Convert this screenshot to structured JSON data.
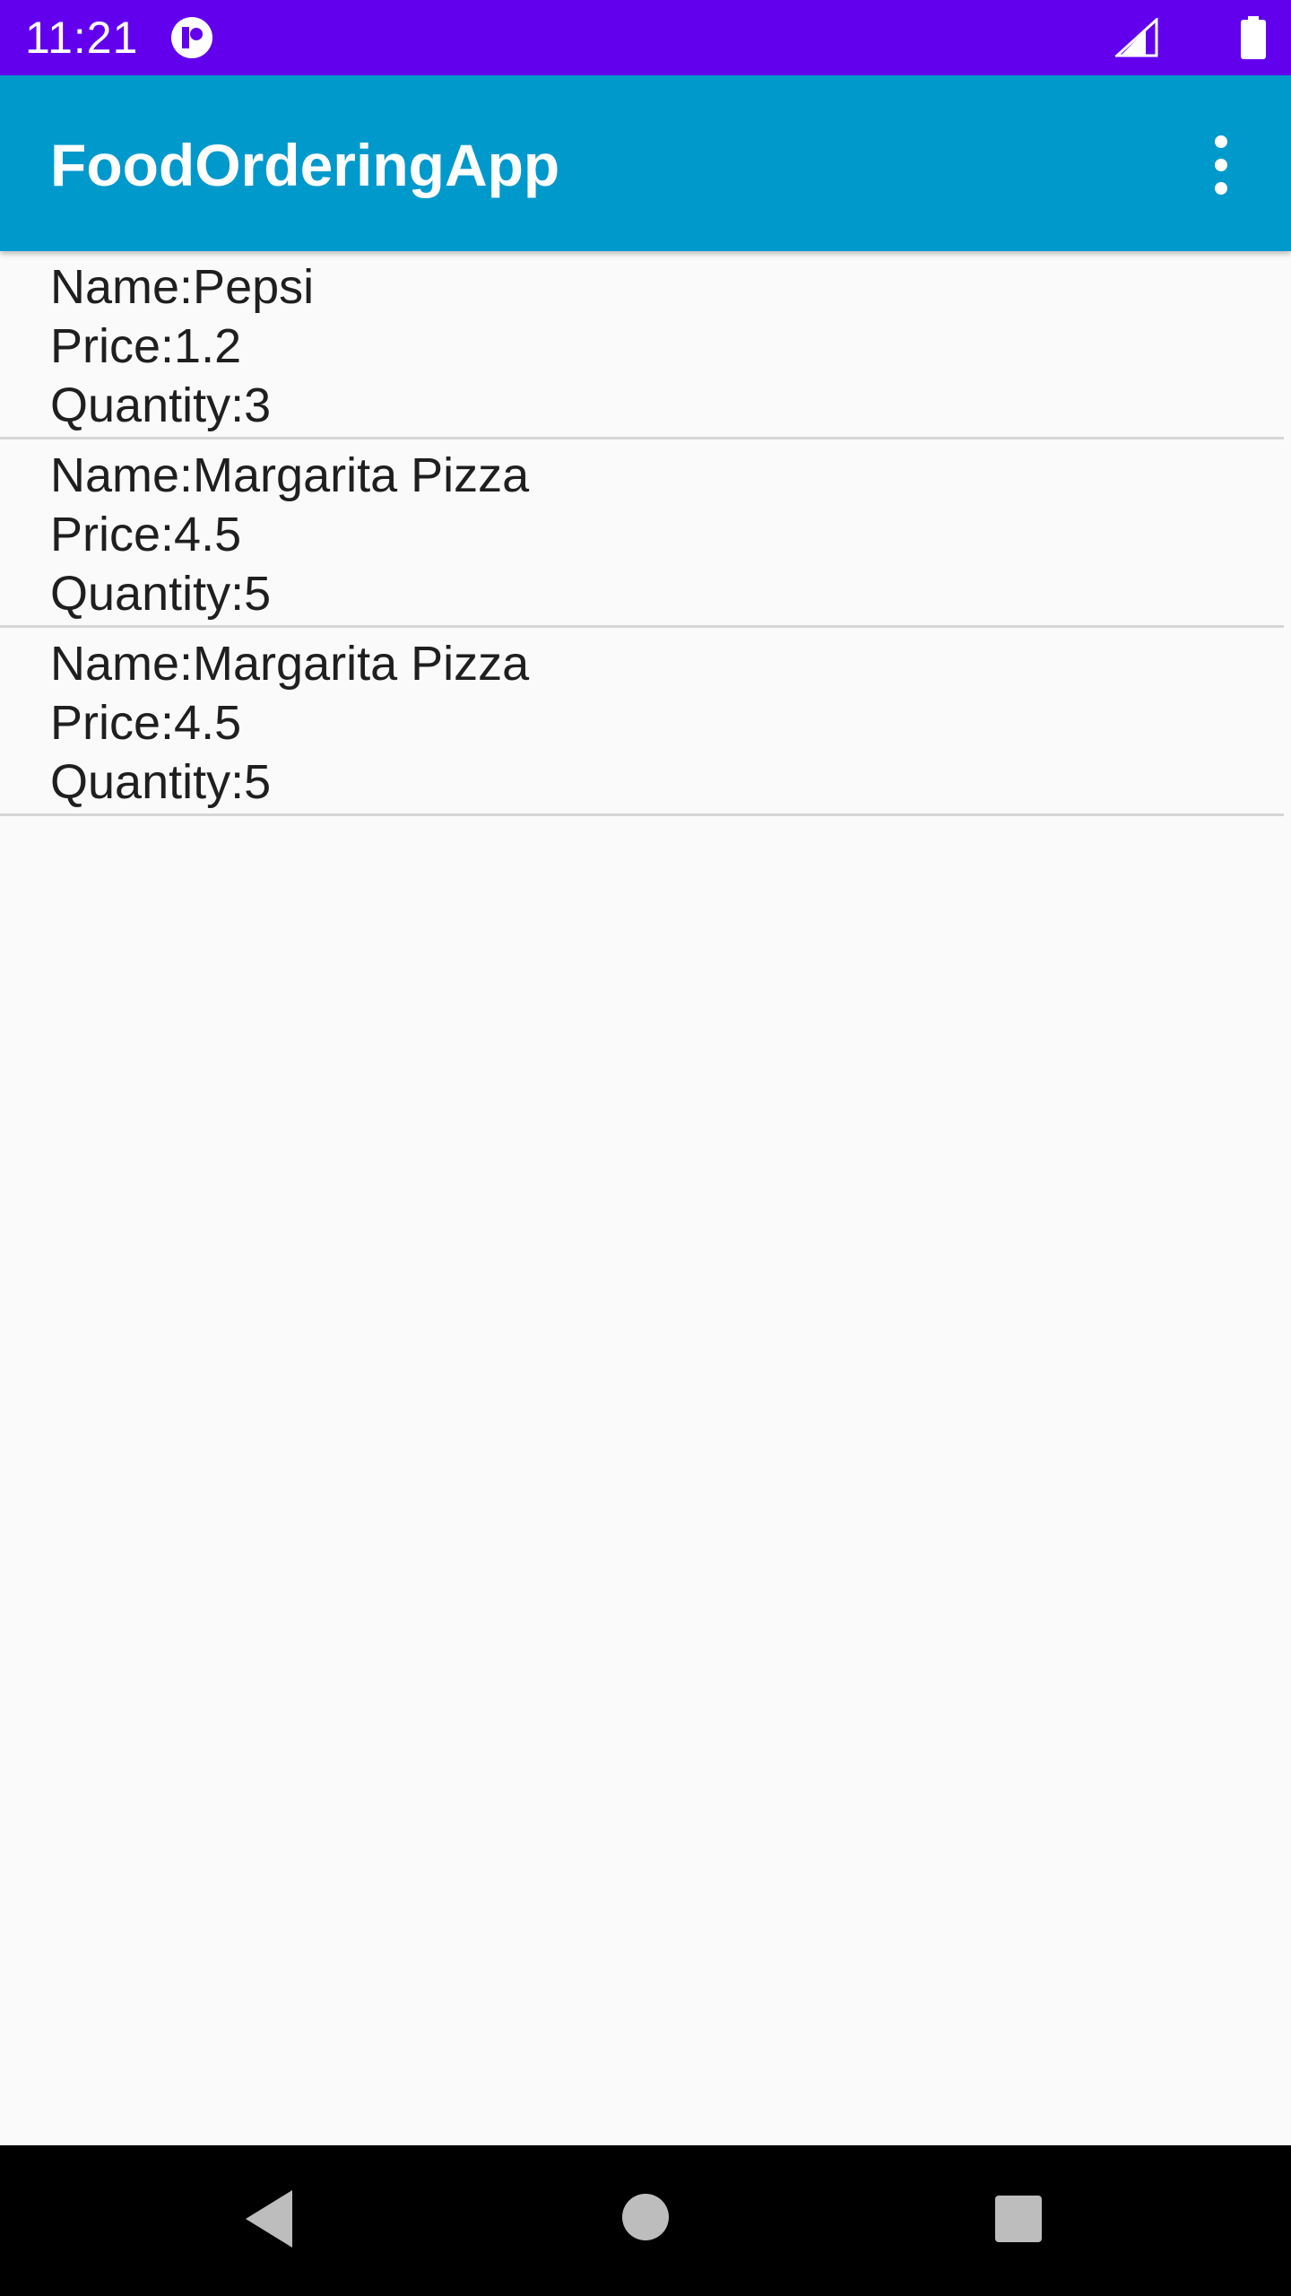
{
  "status_bar": {
    "time": "11:21",
    "icons": [
      "notification-app-icon",
      "cell-signal-icon",
      "battery-icon"
    ],
    "background": "#6200ee"
  },
  "app_bar": {
    "title": "FoodOrderingApp",
    "overflow_icon": "more-vert-icon",
    "background": "#0099cc"
  },
  "orders": [
    {
      "name": "Name:Pepsi",
      "price": "Price:1.2",
      "quantity": "Quantity:3"
    },
    {
      "name": "Name:Margarita Pizza",
      "price": "Price:4.5",
      "quantity": "Quantity:5"
    },
    {
      "name": "Name:Margarita Pizza",
      "price": "Price:4.5",
      "quantity": "Quantity:5"
    }
  ],
  "nav_bar": {
    "buttons": [
      "back-icon",
      "home-icon",
      "recents-icon"
    ]
  }
}
